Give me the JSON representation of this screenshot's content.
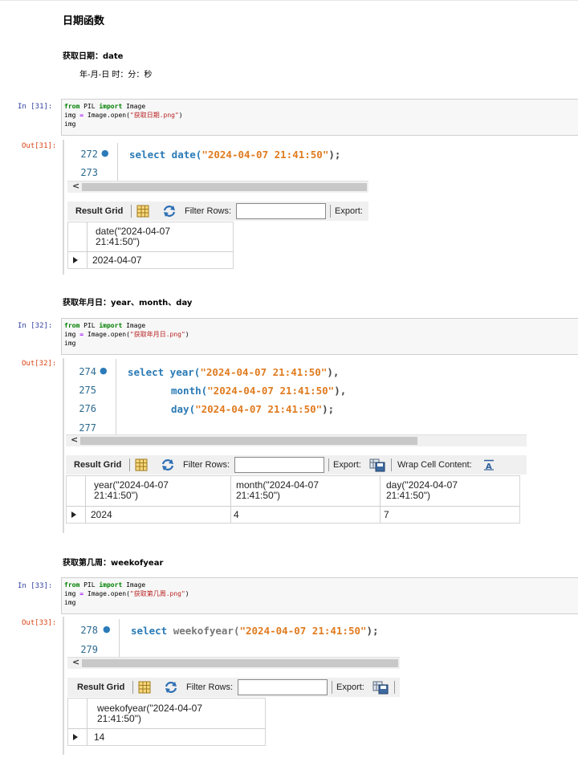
{
  "title": "日期函数",
  "sections": [
    {
      "heading": "获取日期：date",
      "note": "年-月-日 时：分：秒",
      "in_prompt": "In  [31]:",
      "out_prompt": "Out[31]:",
      "code": {
        "l1_kw1": "from",
        "l1_mod": " PIL ",
        "l1_kw2": "import",
        "l1_name": " Image",
        "l2_a": "img ",
        "l2_eq": "=",
        "l2_b": " Image.open(",
        "l2_str": "\"获取日期.png\"",
        "l2_c": ")",
        "l3": "img"
      },
      "sql": {
        "lines": [
          "272",
          "273"
        ],
        "kw": "select date(",
        "str": "\"2024-04-07 21:41:50\"",
        "tail": ");"
      },
      "grid": {
        "header": [
          "date(\"2024-04-07",
          "21:41:50\")"
        ],
        "row": [
          "2024-04-07"
        ]
      }
    },
    {
      "heading": "获取年月日：year、month、day",
      "in_prompt": "In  [32]:",
      "out_prompt": "Out[32]:",
      "code": {
        "l1_kw1": "from",
        "l1_mod": " PIL ",
        "l1_kw2": "import",
        "l1_name": " Image",
        "l2_a": "img ",
        "l2_eq": "=",
        "l2_b": " Image.open(",
        "l2_str": "\"获取年月日.png\"",
        "l2_c": ")",
        "l3": "img"
      },
      "sql": {
        "lines": [
          "274",
          "275",
          "276",
          "277"
        ],
        "l1_kw": "select year(",
        "l1_str": "\"2024-04-07 21:41:50\"",
        "l1_tail": "),",
        "l2_kw": "month(",
        "l2_str": "\"2024-04-07 21:41:50\"",
        "l2_tail": "),",
        "l3_kw": "day(",
        "l3_str": "\"2024-04-07 21:41:50\"",
        "l3_tail": ");"
      },
      "grid": {
        "headers": [
          [
            "year(\"2024-04-07",
            "21:41:50\")"
          ],
          [
            "month(\"2024-04-07",
            "21:41:50\")"
          ],
          [
            "day(\"2024-04-07",
            "21:41:50\")"
          ]
        ],
        "row": [
          "2024",
          "4",
          "7"
        ]
      }
    },
    {
      "heading": "获取第几周：weekofyear",
      "in_prompt": "In  [33]:",
      "out_prompt": "Out[33]:",
      "code": {
        "l1_kw1": "from",
        "l1_mod": " PIL ",
        "l1_kw2": "import",
        "l1_name": " Image",
        "l2_a": "img ",
        "l2_eq": "=",
        "l2_b": " Image.open(",
        "l2_str": "\"获取第几周.png\"",
        "l2_c": ")",
        "l3": "img"
      },
      "sql": {
        "lines": [
          "278",
          "279"
        ],
        "kw": "select ",
        "fn": "weekofyear(",
        "str": "\"2024-04-07 21:41:50\"",
        "tail": ");"
      },
      "grid": {
        "header": [
          "weekofyear(\"2024-04-07",
          "21:41:50\")"
        ],
        "row": [
          "14"
        ]
      }
    }
  ],
  "toolbar": {
    "result_grid": "Result Grid",
    "filter_rows": "Filter Rows:",
    "export": "Export:",
    "wrap": "Wrap Cell Content:",
    "scroll_arrow": "<"
  }
}
